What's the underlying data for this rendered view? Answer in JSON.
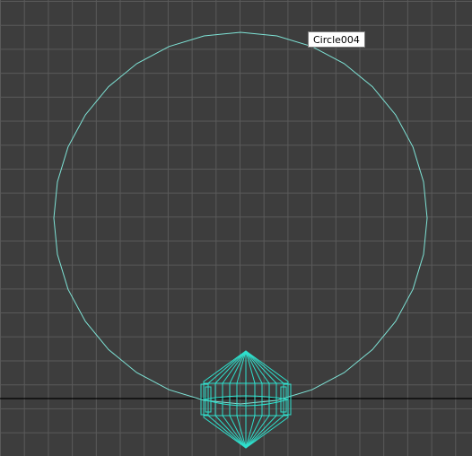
{
  "viewport": {
    "background_color": "#3d3d3d",
    "grid_color": "#5a5a5a",
    "axis_line_color": "#000000",
    "wireframe_color": "#7ee3d6",
    "object_mesh_color": "#2fe0cd"
  },
  "tooltip": {
    "label": "Circle004"
  }
}
